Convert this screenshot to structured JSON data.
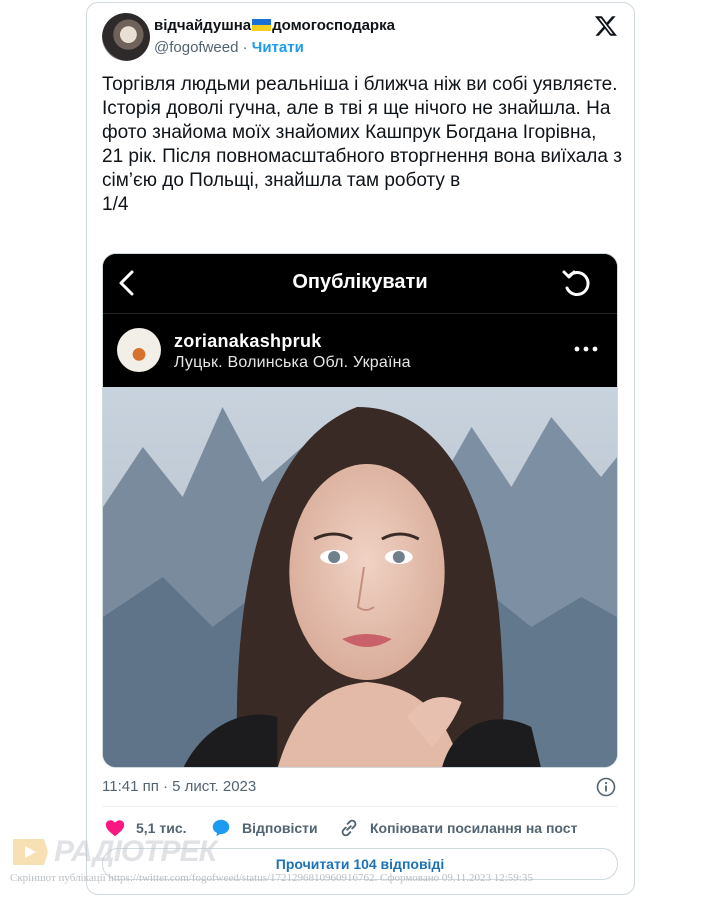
{
  "tweet": {
    "author": {
      "display_name_before_flag": "відчайдушна",
      "display_name_after_flag": "домогосподарка",
      "flag_icon": "ukraine-flag-icon",
      "handle": "@fogofweed",
      "separator": " · ",
      "follow_label": "Читати"
    },
    "text": "Торгівля людьми реальніша і ближча ніж ви собі уявляєте. Історія доволі гучна, але в тві я ще нічого не знайшла. На фото знайома моїх знайомих Кашпрук Богдана Ігорівна, 21 рік. Після повномасштабного вторгнення вона виїхала з сім’єю до Польщі, знайшла там роботу в\n1/4",
    "timestamp": "11:41 пп · 5 лист. 2023",
    "actions": {
      "likes": "5,1 тис.",
      "reply_label": "Відповісти",
      "copy_link_label": "Копіювати посилання на пост"
    },
    "read_replies_label": "Прочитати 104 відповіді"
  },
  "embedded_screenshot": {
    "title": "Опублікувати",
    "username": "zorianakashpruk",
    "location": "Луцьк. Волинська Обл. Україна"
  },
  "watermark": {
    "brand": "РАДІОТРЕК",
    "note": "Скріншот публікації https://twitter.com/fogofweed/status/1721296810960916762. Сформовано 09.11.2023 12:59:35"
  },
  "colors": {
    "link_blue": "#1d9bf0",
    "like_pink": "#f91880",
    "reply_blue": "#1d9bf0",
    "muted_text": "#536471",
    "flag_blue": "#1d6fd6",
    "flag_yellow": "#f5cf20"
  }
}
